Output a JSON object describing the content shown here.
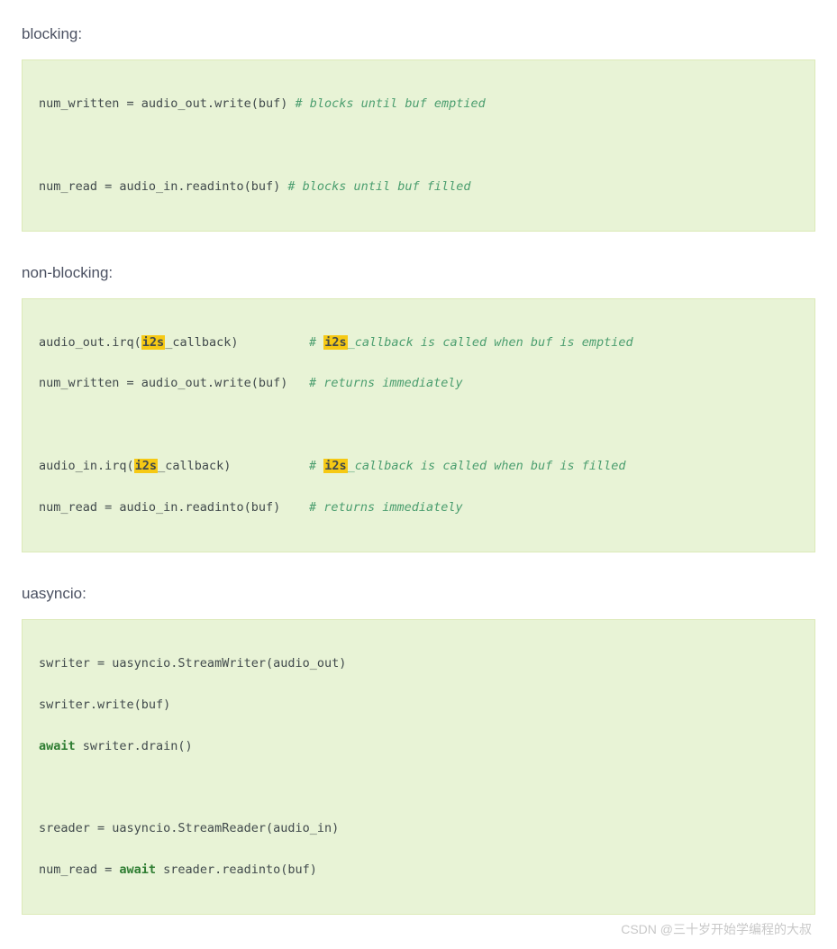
{
  "sections": {
    "blocking": {
      "heading": "blocking:",
      "line1_code": "num_written = audio_out.write(buf) ",
      "line1_comment": "# blocks until buf emptied",
      "line2_code": "num_read = audio_in.readinto(buf) ",
      "line2_comment": "# blocks until buf filled"
    },
    "nonblocking": {
      "heading": "non-blocking:",
      "line1_pre": "audio_out.irq(",
      "line1_hl": "i2s",
      "line1_post": "_callback)",
      "line1_comment_pre": "# ",
      "line1_comment_hl": "i2s",
      "line1_comment_post": "_callback is called when buf is emptied",
      "line2_code": "num_written = audio_out.write(buf)",
      "line2_comment": "# returns immediately",
      "line3_pre": "audio_in.irq(",
      "line3_hl": "i2s",
      "line3_post": "_callback)",
      "line3_comment_pre": "# ",
      "line3_comment_hl": "i2s",
      "line3_comment_post": "_callback is called when buf is filled",
      "line4_code": "num_read = audio_in.readinto(buf)",
      "line4_comment": "# returns immediately"
    },
    "uasyncio": {
      "heading": "uasyncio:",
      "line1": "swriter = uasyncio.StreamWriter(audio_out)",
      "line2": "swriter.write(buf)",
      "line3_kw": "await",
      "line3_rest": " swriter.drain()",
      "line4": "sreader = uasyncio.StreamReader(audio_in)",
      "line5_pre": "num_read = ",
      "line5_kw": "await",
      "line5_rest": " sreader.readinto(buf)"
    }
  },
  "watermark": "CSDN @三十岁开始学编程的大叔"
}
